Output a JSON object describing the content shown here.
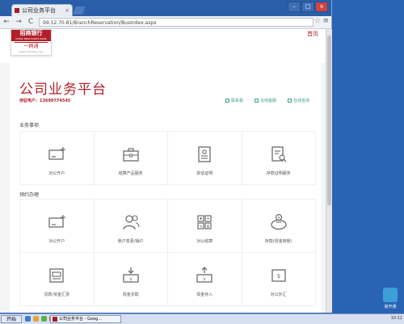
{
  "browser": {
    "tab_title": "公司业务平台",
    "tab_close": "×",
    "url": "99.12.70.81/BranchReservation/BusIndex.aspx",
    "nav": {
      "back": "←",
      "forward": "→",
      "reload": "C",
      "star": "☆",
      "menu": "≡"
    },
    "window": {
      "minimize": "–",
      "maximize": "□",
      "close": "×"
    }
  },
  "header": {
    "logo_name": "招商银行",
    "logo_en": "CHINA MERCHANTS BANK",
    "logo_sub": "一网通",
    "logo_sub_en": "www.cmbchina.com",
    "home_link": "首页"
  },
  "main": {
    "title": "公司业务平台",
    "store_label": "存驻电户：",
    "store_number": "13699774545",
    "actions": [
      {
        "label": "联系我",
        "icon": "contact-icon"
      },
      {
        "label": "在线客服",
        "icon": "service-icon"
      },
      {
        "label": "在线咨询",
        "icon": "consult-icon"
      }
    ]
  },
  "sections": [
    {
      "title": "业务事项",
      "items": [
        {
          "label": "对公开户",
          "icon": "account-open-icon"
        },
        {
          "label": "结算产品服务",
          "icon": "briefcase-icon"
        },
        {
          "label": "资信证明",
          "icon": "document-icon"
        },
        {
          "label": "存款证明服务",
          "icon": "certificate-search-icon"
        }
      ]
    },
    {
      "title": "预约办理",
      "items": [
        {
          "label": "对公开户",
          "icon": "account-open-icon"
        },
        {
          "label": "账户变更/销户",
          "icon": "users-icon"
        },
        {
          "label": "对公结算",
          "icon": "calculator-icon"
        },
        {
          "label": "存款(现金转账)",
          "icon": "piggy-bank-icon"
        },
        {
          "label": "贷款/资金汇票",
          "icon": "loan-icon"
        },
        {
          "label": "现金支取",
          "icon": "cash-withdraw-icon"
        },
        {
          "label": "现金存入",
          "icon": "cash-deposit-icon"
        },
        {
          "label": "对公外汇",
          "icon": "forex-icon"
        }
      ]
    }
  ],
  "taskbar": {
    "start_label": "开始",
    "task_item": "公司业务平台 - Goog...",
    "tray_time": "10:11"
  },
  "desktop": {
    "icon_label": "易开通"
  },
  "colors": {
    "brand_red": "#b0202a",
    "accent_teal": "#3a9a8f",
    "icon_gray": "#6b6b6b"
  }
}
